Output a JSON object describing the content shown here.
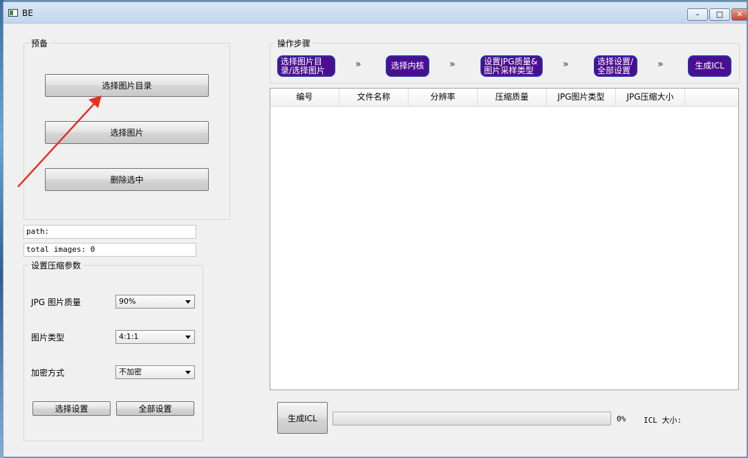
{
  "window": {
    "title": "BE"
  },
  "prep": {
    "title": "预备",
    "btn_select_dir": "选择图片目录",
    "btn_select_img": "选择图片",
    "btn_delete": "删除选中"
  },
  "path_field": "path:",
  "total_field": "total images: 0",
  "compress": {
    "title": "设置压缩参数",
    "quality_label": "JPG 图片质量",
    "quality_value": "90%",
    "type_label": "图片类型",
    "type_value": "4:1:1",
    "encrypt_label": "加密方式",
    "encrypt_value": "不加密",
    "btn_selected": "选择设置",
    "btn_all": "全部设置"
  },
  "steps": {
    "title": "操作步骤",
    "step1": "选择图片目录/选择图片",
    "step2": "选择内核",
    "step3": "设置JPG质量&图片采样类型",
    "step4": "选择设置/全部设置",
    "step5": "生成ICL",
    "sep": "»"
  },
  "table": {
    "columns": [
      "编号",
      "文件名称",
      "分辨率",
      "压缩质量",
      "JPG图片类型",
      "JPG压缩大小"
    ]
  },
  "bottom": {
    "generate_btn": "生成ICL",
    "progress_percent": 0,
    "progress_text": "0%",
    "size_label": "ICL 大小:"
  },
  "colors": {
    "step_bg": "#4a0f8f",
    "step_border": "#2a2ea8",
    "annotation_arrow": "#e53020"
  },
  "icons": {
    "window_controls": [
      "minimize-icon",
      "maximize-icon",
      "close-icon"
    ]
  }
}
